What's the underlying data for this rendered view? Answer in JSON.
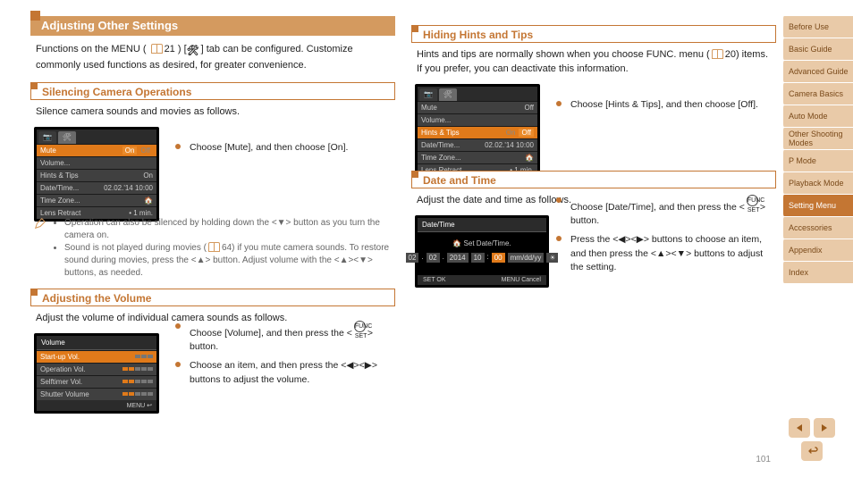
{
  "page_number": "101",
  "left": {
    "heading": "Adjusting Other Settings",
    "intro_before": "Functions on the MENU (",
    "intro_ref": "21",
    "intro_mid": ") [",
    "intro_after": "] tab can be configured. Customize commonly used functions as desired, for greater convenience.",
    "sub1": "Silencing Camera Operations",
    "lcd1": {
      "rows": [
        {
          "k": "Mute",
          "on": "On",
          "off": "Off",
          "sel": true,
          "onSel": true
        },
        {
          "k": "Volume...",
          "v": ""
        },
        {
          "k": "Hints & Tips",
          "v": "On"
        },
        {
          "k": "Date/Time...",
          "v": "02.02.'14 10:00"
        },
        {
          "k": "Time Zone...",
          "v": "🏠"
        },
        {
          "k": "Lens Retract",
          "v": "• 1 min."
        }
      ]
    },
    "step1": "Silence camera sounds and movies as follows.",
    "step1b": "Choose [Mute], and then choose [On].",
    "note1": "Operation can also be silenced by holding down the <▼> button as you turn the camera on.",
    "note2a": "Sound is not played during movies (",
    "note2ref": "64",
    "note2b": ") if you mute camera sounds. To restore sound during movies, press the <▲> button. Adjust volume with the <▲><▼> buttons, as needed.",
    "sub2": "Adjusting the Volume",
    "vol_instr": "Adjust the volume of individual camera sounds as follows.",
    "vol_step1": "Choose [Volume], and then press the <",
    "vol_step1b": "> button.",
    "vol_step2": "Choose an item, and then press the <◀><▶> buttons to adjust the volume.",
    "lcd_vol": {
      "title": "Volume",
      "rows": [
        {
          "k": "Start-up Vol.",
          "fill": 2,
          "sel": true
        },
        {
          "k": "Operation Vol.",
          "fill": 2
        },
        {
          "k": "Selftimer Vol.",
          "fill": 2
        },
        {
          "k": "Shutter Volume",
          "fill": 2
        }
      ],
      "foot": "MENU ↩"
    }
  },
  "right": {
    "sub1": "Hiding Hints and Tips",
    "intro1a": "Hints and tips are normally shown when you choose FUNC. menu (",
    "intro1ref": "20",
    "intro1b": ") items. If you prefer, you can deactivate this information.",
    "step1": "Choose [Hints & Tips], and then choose [Off].",
    "lcd2": {
      "rows": [
        {
          "k": "Mute",
          "v": "Off"
        },
        {
          "k": "Volume...",
          "v": ""
        },
        {
          "k": "Hints & Tips",
          "on": "On",
          "off": "Off",
          "sel": true,
          "onSel": false
        },
        {
          "k": "Date/Time...",
          "v": "02.02.'14 10:00"
        },
        {
          "k": "Time Zone...",
          "v": "🏠"
        },
        {
          "k": "Lens Retract",
          "v": "• 1 min."
        }
      ]
    },
    "sub2": "Date and Time",
    "dt_intro": "Adjust the date and time as follows.",
    "dt_step1a": "Choose [Date/Time], and then press the <",
    "dt_step1b": "> button.",
    "dt_step2": "Press the <◀><▶> buttons to choose an item, and then press the <▲><▼> buttons to adjust the setting.",
    "lcd_dt": {
      "title": "Date/Time",
      "label": "🏠 Set Date/Time.",
      "boxes": [
        "02",
        "02",
        "2014",
        "10",
        "00",
        "mm/dd/yy",
        "☀"
      ],
      "sel_index": 4,
      "ok": "SET OK",
      "cancel": "MENU Cancel"
    }
  },
  "sidebar": [
    {
      "label": "Before Use",
      "active": false
    },
    {
      "label": "Basic Guide",
      "active": false
    },
    {
      "label": "Advanced Guide",
      "active": false
    },
    {
      "label": "Camera Basics",
      "active": false
    },
    {
      "label": "Auto Mode",
      "active": false
    },
    {
      "label": "Other Shooting Modes",
      "active": false
    },
    {
      "label": "P Mode",
      "active": false
    },
    {
      "label": "Playback Mode",
      "active": false
    },
    {
      "label": "Setting Menu",
      "active": true
    },
    {
      "label": "Accessories",
      "active": false
    },
    {
      "label": "Appendix",
      "active": false
    },
    {
      "label": "Index",
      "active": false
    }
  ]
}
